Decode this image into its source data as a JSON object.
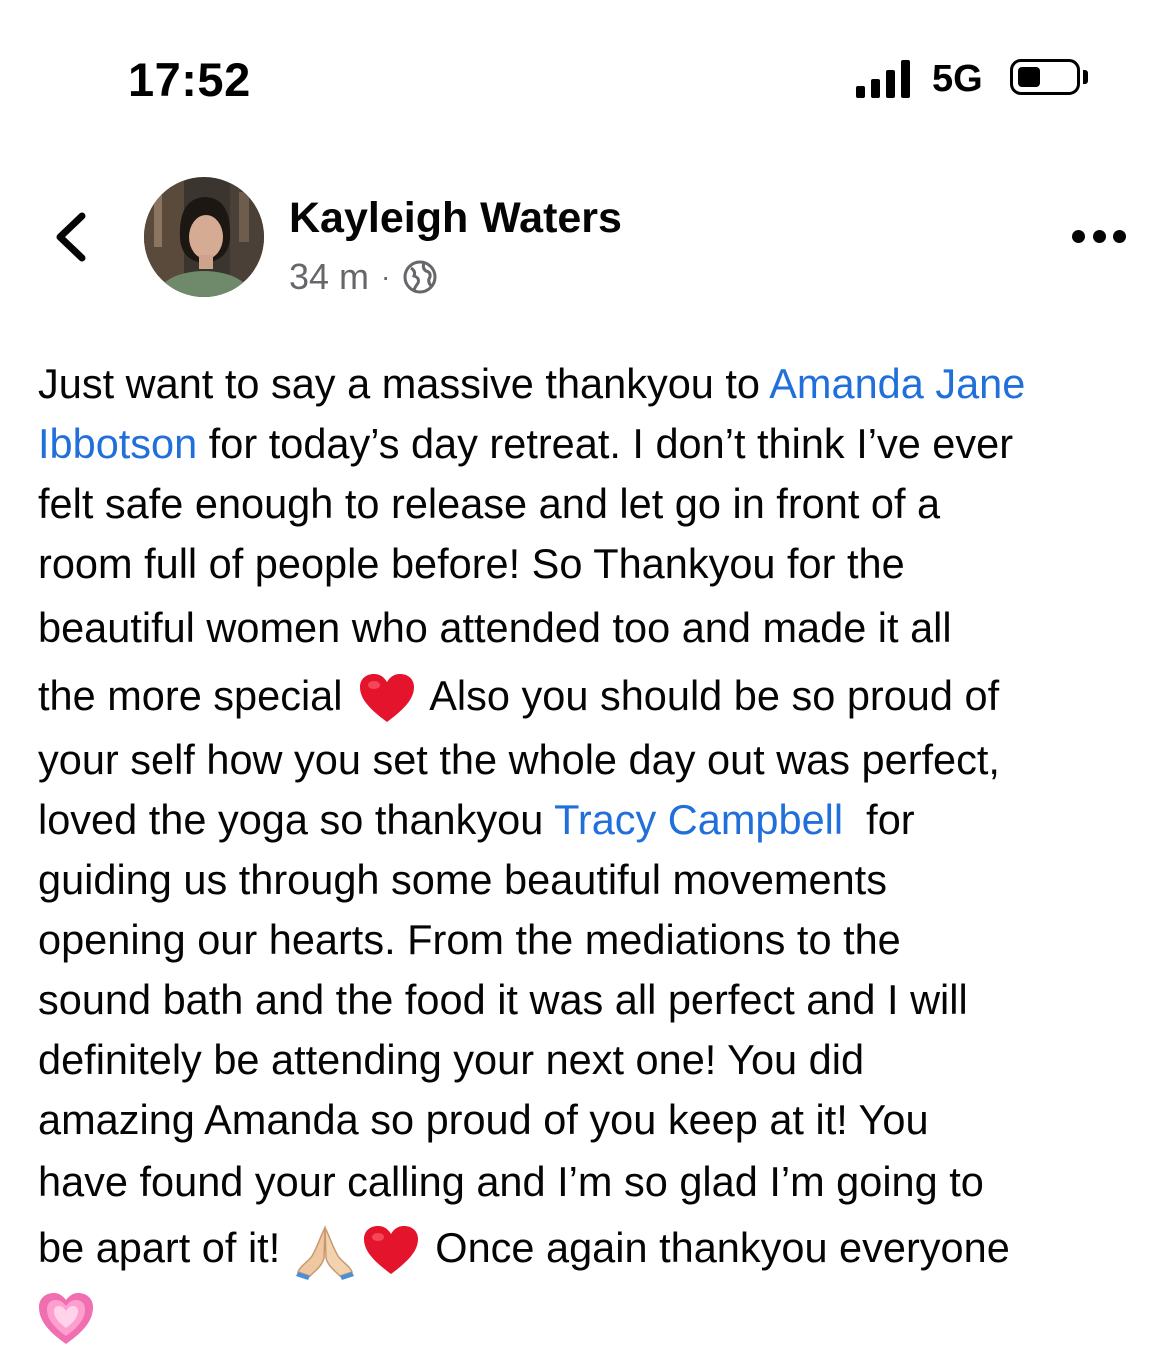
{
  "status_bar": {
    "time": "17:52",
    "network": "5G"
  },
  "post": {
    "author": "Kayleigh Waters",
    "timestamp": "34 m",
    "separator": "·",
    "lines": {
      "l1_a": "Just want to say a massive thankyou to ",
      "l1_m": "Amanda Jane",
      "l2_m": "Ibbotson",
      "l2_b": " for today’s day retreat. I don’t think I’ve ever",
      "l3": "felt safe enough to release and let go in front of a",
      "l4": "room full of people before! So Thankyou for the",
      "l5": "beautiful women who attended too and made it all",
      "l6_a": "the more special ",
      "l6_b": " Also you should be so proud of",
      "l7": "your self how you set the whole day out was perfect,",
      "l8_a": "loved the yoga so thankyou ",
      "l8_m": "Tracy Campbell",
      "l8_b": "  for",
      "l9": "guiding us through some beautiful movements",
      "l10": "opening our hearts. From the mediations to the",
      "l11": "sound bath and the food it was all perfect and I will",
      "l12": "definitely be attending your next one! You did",
      "l13": "amazing Amanda so proud of you keep at it! You",
      "l14": "have found your calling and I’m so glad I’m going to",
      "l15_a": "be apart of it! ",
      "l15_b": " Once again thankyou everyone"
    },
    "emojis": [
      "red-heart",
      "folded-hands",
      "red-heart",
      "growing-heart"
    ]
  },
  "colors": {
    "text": "#050505",
    "mention": "#216fdb",
    "secondary": "#65676b"
  }
}
